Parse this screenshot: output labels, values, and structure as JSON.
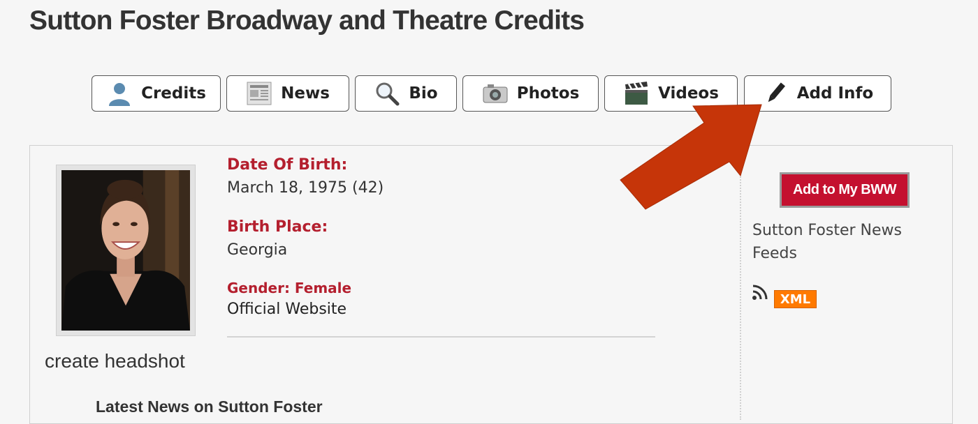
{
  "page": {
    "title": "Sutton Foster Broadway and Theatre Credits"
  },
  "tabs": [
    {
      "label": "Credits",
      "icon": "person-icon"
    },
    {
      "label": "News",
      "icon": "newspaper-icon"
    },
    {
      "label": "Bio",
      "icon": "magnifier-icon"
    },
    {
      "label": "Photos",
      "icon": "camera-icon"
    },
    {
      "label": "Videos",
      "icon": "clapperboard-icon"
    },
    {
      "label": "Add Info",
      "icon": "pencil-icon"
    }
  ],
  "profile": {
    "dob_label": "Date Of Birth:",
    "dob_value": "March 18, 1975 (42)",
    "birthplace_label": "Birth Place:",
    "birthplace_value": "Georgia",
    "gender_label": "Gender: Female",
    "website_link": "Official Website",
    "create_headshot": "create headshot",
    "latest_news": "Latest News on Sutton Foster"
  },
  "sidebar": {
    "add_button": "Add to My BWW",
    "feeds_text": "Sutton Foster News Feeds",
    "xml_badge": "XML"
  },
  "colors": {
    "accent_red": "#b41f2e",
    "button_red": "#c4102f",
    "annotation_arrow": "#c63509",
    "xml_orange": "#ff7a00"
  }
}
